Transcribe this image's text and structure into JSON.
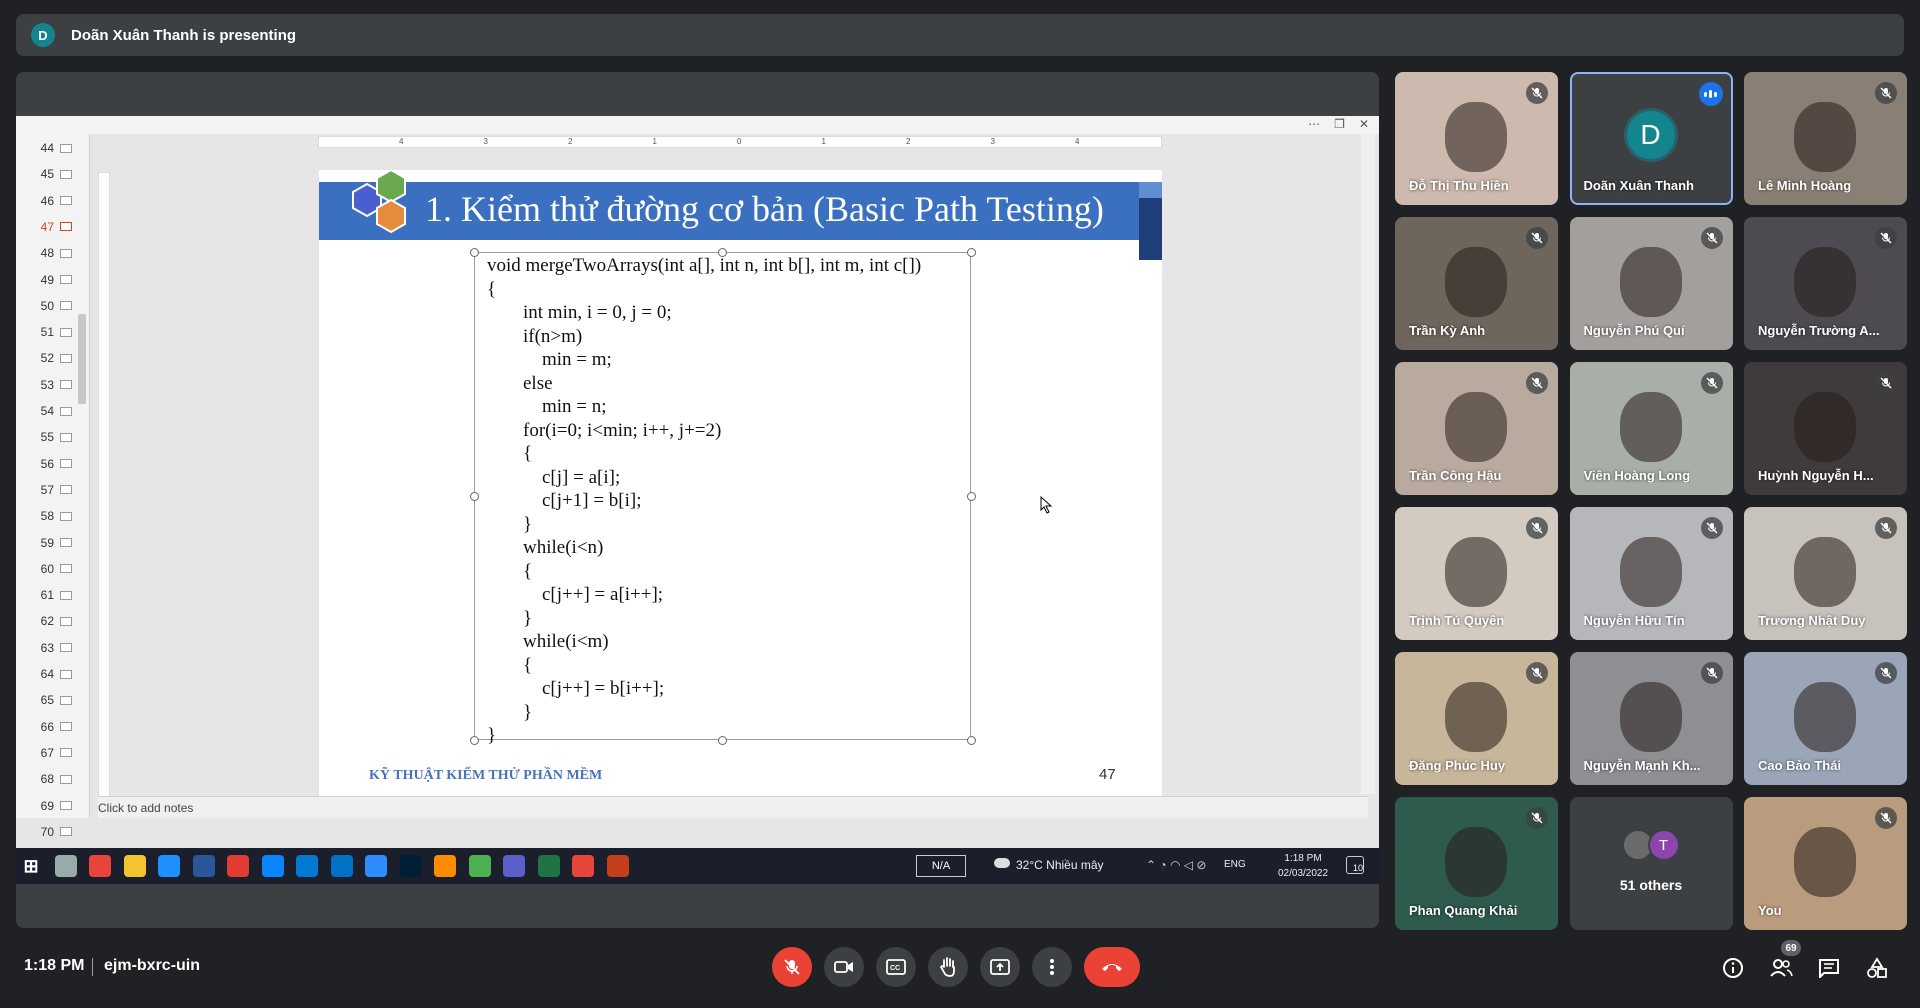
{
  "presenter": {
    "initial": "D",
    "text": "Doãn Xuân Thanh is presenting"
  },
  "powerpoint": {
    "slide_numbers": [
      "44",
      "45",
      "46",
      "47",
      "48",
      "49",
      "50",
      "51",
      "52",
      "53",
      "54",
      "55",
      "56",
      "57",
      "58",
      "59",
      "60",
      "61",
      "62",
      "63",
      "64",
      "65",
      "66",
      "67",
      "68",
      "69",
      "70"
    ],
    "active_slide": "47",
    "ruler_labels": [
      "4",
      "3",
      "2",
      "1",
      "0",
      "1",
      "2",
      "3",
      "4"
    ],
    "notes_placeholder": "Click to add notes"
  },
  "slide": {
    "title": "1. Kiểm thử đường cơ bản (Basic Path Testing)",
    "code": [
      "void mergeTwoArrays(int a[], int n, int b[], int m, int c[])",
      "{",
      "int min, i = 0, j = 0;",
      "if(n>m)",
      "min = m;",
      "else",
      "min = n;",
      "for(i=0; i<min; i++, j+=2)",
      "{",
      "c[j] = a[i];",
      "c[j+1] = b[i];",
      "}",
      "while(i<n)",
      "{",
      "c[j++] = a[i++];",
      "}",
      "while(i<m)",
      "{",
      "c[j++] = b[i++];",
      "}",
      "}"
    ],
    "footer": "KỸ THUẬT KIỂM THỬ PHẦN MỀM",
    "number": "47",
    "colors": {
      "title_band": "#3b6fbf",
      "footer_text": "#4a72b8"
    }
  },
  "taskbar": {
    "apps": [
      "start",
      "task-view",
      "chrome",
      "explorer",
      "edge",
      "word",
      "app-red",
      "zalo",
      "app-blue",
      "outlook",
      "zoom",
      "photoshop",
      "app-orange",
      "app-green",
      "teams",
      "excel",
      "chrome-alt",
      "powerpoint"
    ],
    "na_label": "N/A",
    "weather": "32°C  Nhiều mây",
    "lang": "ENG",
    "time": "1:18 PM",
    "date": "02/03/2022",
    "notif_count": "10"
  },
  "participants": [
    {
      "name": "Đỗ Thị Thu Hiền",
      "bg": "#cdb9ad"
    },
    {
      "name": "Doãn Xuân Thanh",
      "bg": "#3c4043",
      "avatar": "D",
      "speaking": true
    },
    {
      "name": "Lê Minh Hoàng",
      "bg": "#8a7f74"
    },
    {
      "name": "Trần Kỳ Anh",
      "bg": "#6e665c"
    },
    {
      "name": "Nguyễn Phú Quí",
      "bg": "#a39f9c"
    },
    {
      "name": "Nguyễn Trường A...",
      "bg": "#4d4a52"
    },
    {
      "name": "Trần Công Hậu",
      "bg": "#b9aaa0"
    },
    {
      "name": "Viên Hoàng Long",
      "bg": "#a8aea8"
    },
    {
      "name": "Huỳnh Nguyễn H...",
      "bg": "#3f3a3c"
    },
    {
      "name": "Trịnh Tú Quyên",
      "bg": "#d3cbc2"
    },
    {
      "name": "Nguyễn Hữu Tín",
      "bg": "#b6b7bb"
    },
    {
      "name": "Trương Nhật Duy",
      "bg": "#c8c2bd"
    },
    {
      "name": "Đặng Phúc Huy",
      "bg": "#c7b69a"
    },
    {
      "name": "Nguyễn Mạnh Kh...",
      "bg": "#8d8f93"
    },
    {
      "name": "Cao Bảo Thái",
      "bg": "#9aa6b8"
    },
    {
      "name": "Phan Quang Khải",
      "bg": "#2f5a4e"
    },
    {
      "name": "51 others",
      "bg": "#3c4043",
      "others": true,
      "other_initial": "T"
    },
    {
      "name": "You",
      "bg": "#b99c7e"
    }
  ],
  "bottom": {
    "time": "1:18 PM",
    "meeting_code": "ejm-bxrc-uin",
    "people_count": "69"
  }
}
